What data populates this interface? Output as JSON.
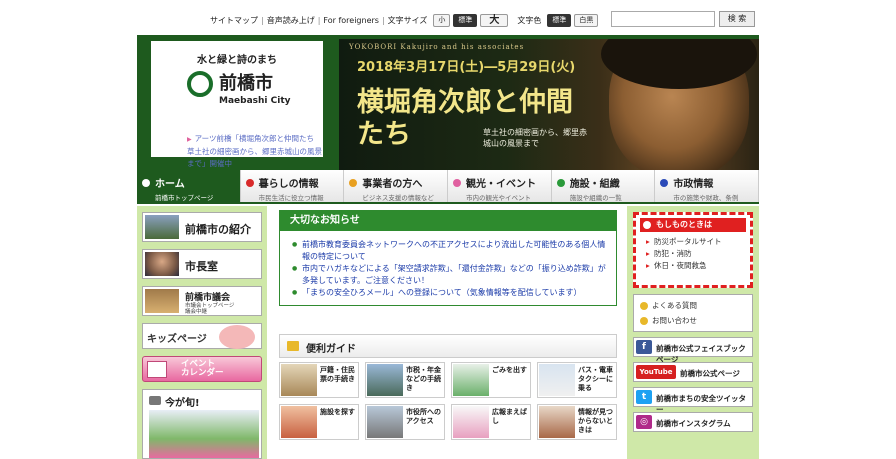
{
  "util_nav": {
    "sitemap": "サイトマップ",
    "voice": "音声読み上げ",
    "foreigners": "For foreigners",
    "text_size_label": "文字サイズ",
    "size_small": "小",
    "size_standard": "標準",
    "size_large": "大",
    "text_color_label": "文字色",
    "color_standard": "標準",
    "color_bw": "白黒",
    "search_button": "検 索",
    "search_placeholder": ""
  },
  "logo": {
    "tagline": "水と緑と詩のまち",
    "city_name": "前橋市",
    "city_roman": "Maebashi City"
  },
  "notice_text": "アーツ前橋「横堀角次郎と仲間たち　草土社の細密画から、郷里赤城山の風景まで」開催中",
  "banner": {
    "english_title": "YOKOBORI Kakujiro and his associates",
    "dates": "2018年3月17日(土)―5月29日(火)",
    "title": "横堀角次郎と仲間たち",
    "subtitle": "草土社の細密画から、郷里赤城山の風景まで"
  },
  "global_nav": [
    {
      "label": "ホーム",
      "sub": "前橋市トップページ",
      "color": "#ffffff"
    },
    {
      "label": "暮らしの情報",
      "sub": "市民生活に役立つ情報",
      "color": "#d82a2a"
    },
    {
      "label": "事業者の方へ",
      "sub": "ビジネス支援の情報など",
      "color": "#e8a020"
    },
    {
      "label": "観光・イベント",
      "sub": "市内の観光やイベント",
      "color": "#e060a0"
    },
    {
      "label": "施設・組織",
      "sub": "施設や組織の一覧",
      "color": "#2a9a3a"
    },
    {
      "label": "市政情報",
      "sub": "市の施策や财政、条例",
      "color": "#2a4ab8"
    }
  ],
  "left_menu": {
    "intro": "前橋市の紹介",
    "mayor": "市長室",
    "council": "前橋市議会",
    "council_sub1": "市議会トップページ",
    "council_sub2": "議会中継",
    "kids": "キッズページ",
    "event": "イベント\nカレンダー",
    "now": "今が旬!"
  },
  "important": {
    "heading": "大切なお知らせ",
    "items": [
      "前橋市教育委員会ネットワークへの不正アクセスにより流出した可能性のある個人情報の特定について",
      "市内でハガキなどによる「架空請求詐欺」、「還付金詐欺」などの「振り込め詐欺」が多発しています。ご注意ください！",
      "「まちの安全ひろメール」への登録について（気象情報等を配信しています）"
    ]
  },
  "guide": {
    "heading": "便利ガイド",
    "tiles": [
      "戸籍・住民票の手続き",
      "市税・年金などの手続き",
      "ごみを出す",
      "バス・電車タクシーに乗る",
      "施設を探す",
      "市役所へのアクセス",
      "広報まえばし",
      "情報が見つからないときは"
    ]
  },
  "right": {
    "mosimo_heading": "もしものときは",
    "mosimo_items": [
      "防災ポータルサイト",
      "防犯・消防",
      "休日・夜間救急"
    ],
    "faq": "よくある質問",
    "contact": "お問い合わせ",
    "facebook": "前橋市公式フェイスブックページ",
    "youtube_logo": "YouTube",
    "youtube": "前橋市公式ページ",
    "twitter": "前橋市まちの安全ツイッター",
    "instagram": "前橋市インスタグラム"
  },
  "colors": {
    "brand_green": "#1e5a1e",
    "notice_green": "#2e8b2e",
    "emergency_red": "#e02020"
  }
}
